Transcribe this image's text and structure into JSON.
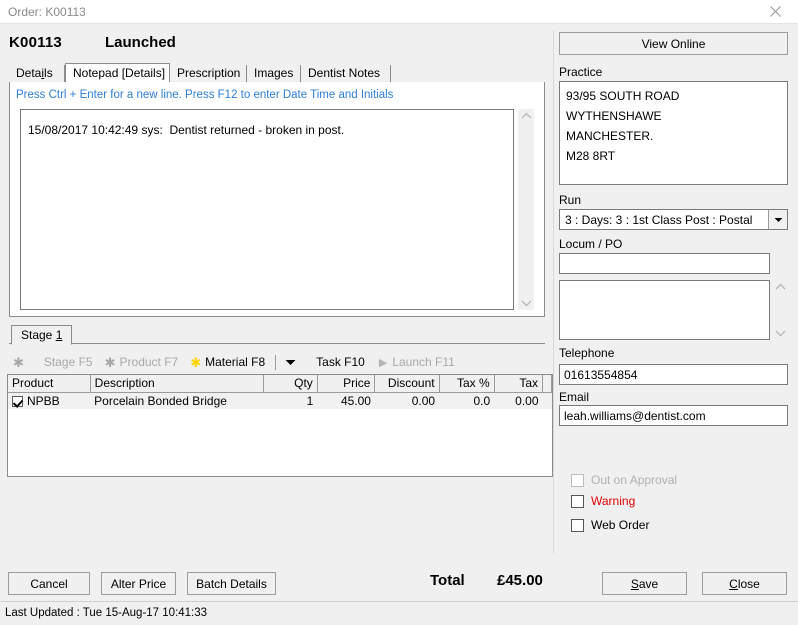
{
  "titlebar": {
    "caption": "Order: K00113",
    "close_icon": "close-icon"
  },
  "header": {
    "order_number": "K00113",
    "status": "Launched"
  },
  "tabs": [
    {
      "label": "Details",
      "accel": "i",
      "active": false
    },
    {
      "label": "Notepad [Details]",
      "active": true
    },
    {
      "label": "Prescription",
      "active": false
    },
    {
      "label": "Images",
      "active": false
    },
    {
      "label": "Dentist Notes",
      "active": false
    }
  ],
  "notepad": {
    "hint": "Press Ctrl + Enter for a new line.  Press F12 to enter Date Time and Initials",
    "text": "15/08/2017 10:42:49 sys:  Dentist returned - broken in post.",
    "scroll_up_icon": "chevron-up-icon",
    "scroll_down_icon": "chevron-down-icon"
  },
  "stage": {
    "tab_label": "Stage",
    "tab_accel": "1"
  },
  "action_toolbar": {
    "items": [
      {
        "icon": "asterisk-icon",
        "icon_color": "gray",
        "label": "Stage F5",
        "enabled": false
      },
      {
        "icon": "asterisk-icon",
        "icon_color": "gray",
        "label": "Product F7",
        "enabled": false
      },
      {
        "icon": "asterisk-icon",
        "icon_color": "yellow",
        "label": "Material F8",
        "enabled": true
      }
    ],
    "dropdown_icon": "caret-down-icon",
    "task_label": "Task F10",
    "launch_icon": "play-triangle-icon",
    "launch_label": "Launch F11"
  },
  "grid": {
    "columns": [
      "Product",
      "Description",
      "Qty",
      "Price",
      "Discount",
      "Tax %",
      "Tax"
    ],
    "rows": [
      {
        "checked": true,
        "product": "NPBB",
        "description": "Porcelain Bonded Bridge",
        "qty": "1",
        "price": "45.00",
        "discount": "0.00",
        "tax_pct": "0.0",
        "tax": "0.00"
      }
    ]
  },
  "right_panel": {
    "view_online_label": "View Online",
    "practice_label": "Practice",
    "practice_address": "93/95 SOUTH ROAD\nWYTHENSHAWE\nMANCHESTER.\nM28 8RT",
    "run_label": "Run",
    "run_value": "3 : Days: 3 : 1st Class Post : Postal",
    "run_arrow_icon": "caret-down-icon",
    "locum_label": "Locum / PO",
    "locum_value": "",
    "notes_value": "",
    "notes_scroll_up_icon": "chevron-up-icon",
    "notes_scroll_down_icon": "chevron-down-icon",
    "telephone_label": "Telephone",
    "telephone_value": "01613554854",
    "email_label": "Email",
    "email_value": "leah.williams@dentist.com",
    "checkboxes": [
      {
        "label": "Out on Approval",
        "checked": false,
        "enabled": false,
        "style": "dim"
      },
      {
        "label": "Warning",
        "checked": false,
        "enabled": true,
        "style": "warn"
      },
      {
        "label": "Web Order",
        "checked": false,
        "enabled": true,
        "style": "normal"
      }
    ]
  },
  "footer": {
    "cancel_label": "Cancel",
    "alter_price_label": "Alter Price",
    "batch_details_label": "Batch Details",
    "total_label": "Total",
    "total_value": "£45.00",
    "save_label": "Save",
    "save_accel": "S",
    "close_label": "Close",
    "close_accel": "C"
  },
  "statusbar": {
    "text": "Last Updated : Tue 15-Aug-17 10:41:33"
  },
  "colors": {
    "hint_blue": "#2f7fd6",
    "warning_red": "#e00000",
    "asterisk_yellow": "#ffd400",
    "window_bg": "#f0f0f0"
  }
}
